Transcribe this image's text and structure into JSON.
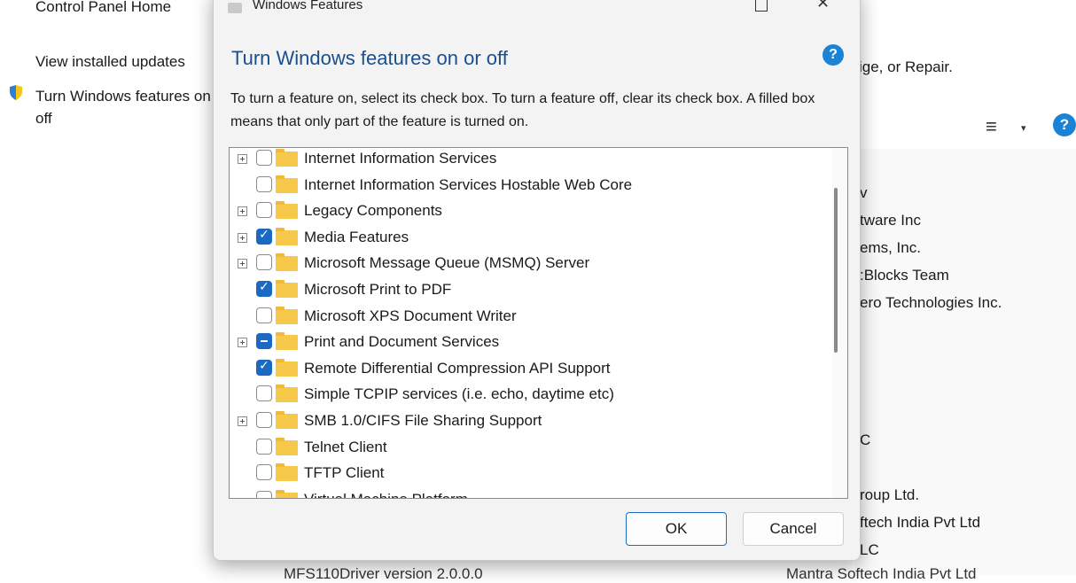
{
  "control_panel": {
    "home_link": "Control Panel Home",
    "updates_link": "View installed updates",
    "features_link_line1": "Turn Windows features on or",
    "features_link_line2": "off",
    "header_text_partial": "ige, or Repair."
  },
  "right_list": {
    "items": [
      "v",
      "tware Inc",
      "ems, Inc.",
      ":Blocks Team",
      "ero Technologies Inc.",
      "",
      "",
      "",
      "",
      "C",
      "",
      "roup Ltd.",
      "ftech India Pvt Ltd",
      "LC"
    ],
    "bottom_left": "MFS110Driver version 2.0.0.0",
    "bottom_right": "Mantra Softech India Pvt Ltd"
  },
  "dialog": {
    "title": "Windows Features",
    "heading": "Turn Windows features on or off",
    "help": "?",
    "description": "To turn a feature on, select its check box. To turn a feature off, clear its check box. A filled box means that only part of the feature is turned on.",
    "features": [
      {
        "label": "Internet Information Services",
        "expandable": true,
        "state": "unchecked"
      },
      {
        "label": "Internet Information Services Hostable Web Core",
        "expandable": false,
        "state": "unchecked"
      },
      {
        "label": "Legacy Components",
        "expandable": true,
        "state": "unchecked"
      },
      {
        "label": "Media Features",
        "expandable": true,
        "state": "checked"
      },
      {
        "label": "Microsoft Message Queue (MSMQ) Server",
        "expandable": true,
        "state": "unchecked"
      },
      {
        "label": "Microsoft Print to PDF",
        "expandable": false,
        "state": "checked"
      },
      {
        "label": "Microsoft XPS Document Writer",
        "expandable": false,
        "state": "unchecked"
      },
      {
        "label": "Print and Document Services",
        "expandable": true,
        "state": "partial"
      },
      {
        "label": "Remote Differential Compression API Support",
        "expandable": false,
        "state": "checked"
      },
      {
        "label": "Simple TCPIP services (i.e. echo, daytime etc)",
        "expandable": false,
        "state": "unchecked"
      },
      {
        "label": "SMB 1.0/CIFS File Sharing Support",
        "expandable": true,
        "state": "unchecked"
      },
      {
        "label": "Telnet Client",
        "expandable": false,
        "state": "unchecked"
      },
      {
        "label": "TFTP Client",
        "expandable": false,
        "state": "unchecked"
      },
      {
        "label": "Virtual Machine Platform",
        "expandable": false,
        "state": "unchecked"
      }
    ],
    "ok_label": "OK",
    "cancel_label": "Cancel"
  },
  "colors": {
    "heading": "#1a4f8f",
    "accent": "#1a69c3",
    "folder": "#f7c94a"
  }
}
